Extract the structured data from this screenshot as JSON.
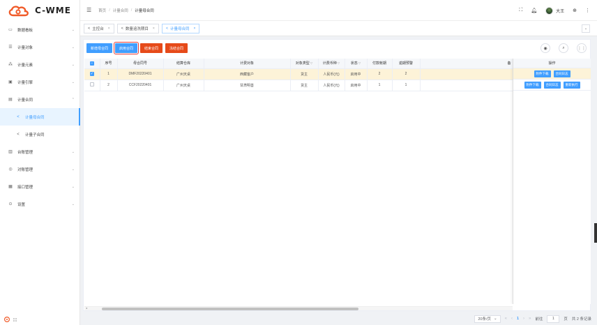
{
  "app": {
    "logo_text": "C-WME",
    "colors": {
      "primary": "#409eff",
      "danger": "#e64a19",
      "selected_row": "#fdf3d8",
      "logo_orange": "#f05a28"
    }
  },
  "sidebar": {
    "items": [
      {
        "label": "数据看板",
        "icon": "monitor-icon",
        "arrow": "⌄"
      },
      {
        "label": "计量对象",
        "icon": "database-icon",
        "arrow": "⌄"
      },
      {
        "label": "计量元素",
        "icon": "elements-icon",
        "arrow": "⌄"
      },
      {
        "label": "计量引擎",
        "icon": "engine-icon",
        "arrow": "⌄"
      },
      {
        "label": "计量合同",
        "icon": "contract-icon",
        "arrow": "⌃"
      },
      {
        "label": "计量母合同",
        "icon": "share-icon",
        "arrow": "",
        "sub": true,
        "active": true
      },
      {
        "label": "计量子合同",
        "icon": "share-icon",
        "arrow": "",
        "sub": true
      },
      {
        "label": "台账管理",
        "icon": "ledger-icon",
        "arrow": "⌄"
      },
      {
        "label": "对账管理",
        "icon": "reconcile-icon",
        "arrow": "⌄"
      },
      {
        "label": "接口管理",
        "icon": "interface-icon",
        "arrow": "⌄"
      },
      {
        "label": "设置",
        "icon": "settings-icon",
        "arrow": "⌄"
      }
    ]
  },
  "header": {
    "breadcrumb": [
      "首页",
      "计量合同",
      "计量母合同"
    ],
    "username": "大王",
    "icons": [
      "fullscreen-icon",
      "bell-icon",
      "avatar",
      "globe-icon",
      "more-icon"
    ]
  },
  "tabs": [
    {
      "label": "主控台",
      "active": false
    },
    {
      "label": "数量追洗期目",
      "active": false
    },
    {
      "label": "计量母合同",
      "active": true
    }
  ],
  "toolbar": {
    "buttons": [
      {
        "label": "新增母合同",
        "style": "blue"
      },
      {
        "label": "启用合同",
        "style": "blue",
        "highlighted": true
      },
      {
        "label": "结束合同",
        "style": "red"
      },
      {
        "label": "冻结合同",
        "style": "red"
      }
    ]
  },
  "table": {
    "columns": [
      "序号",
      "母合同号",
      "结算仓库",
      "计费对象",
      "对象类型",
      "计费币种",
      "状态",
      "付款帐期",
      "逾期预警",
      "备"
    ],
    "filter_columns": [
      4,
      5,
      6
    ],
    "rows": [
      {
        "index": "1",
        "contract_no": "DMF20220401",
        "warehouse": "广州天桌",
        "object": "西藏客户",
        "object_type": "货主",
        "currency": "人民币(元)",
        "status": "启用中",
        "payment_term": "2",
        "overdue_warning": "2",
        "note": "",
        "selected": true
      },
      {
        "index": "2",
        "contract_no": "CCF20220401",
        "warehouse": "广州天桌",
        "object": "甘肃明善",
        "object_type": "货主",
        "currency": "人民币(元)",
        "status": "启用中",
        "payment_term": "1",
        "overdue_warning": "1",
        "note": "",
        "selected": false
      }
    ],
    "ops_header": "操作",
    "ops": [
      [
        "附件下载",
        "合同日志"
      ],
      [
        "附件下载",
        "合同日志",
        "重新执行"
      ]
    ]
  },
  "pager": {
    "page_size": "20条/页",
    "current_page": "1",
    "goto_label": "前往",
    "goto_value": "1",
    "page_unit": "页",
    "total": "共 2 条记录"
  }
}
